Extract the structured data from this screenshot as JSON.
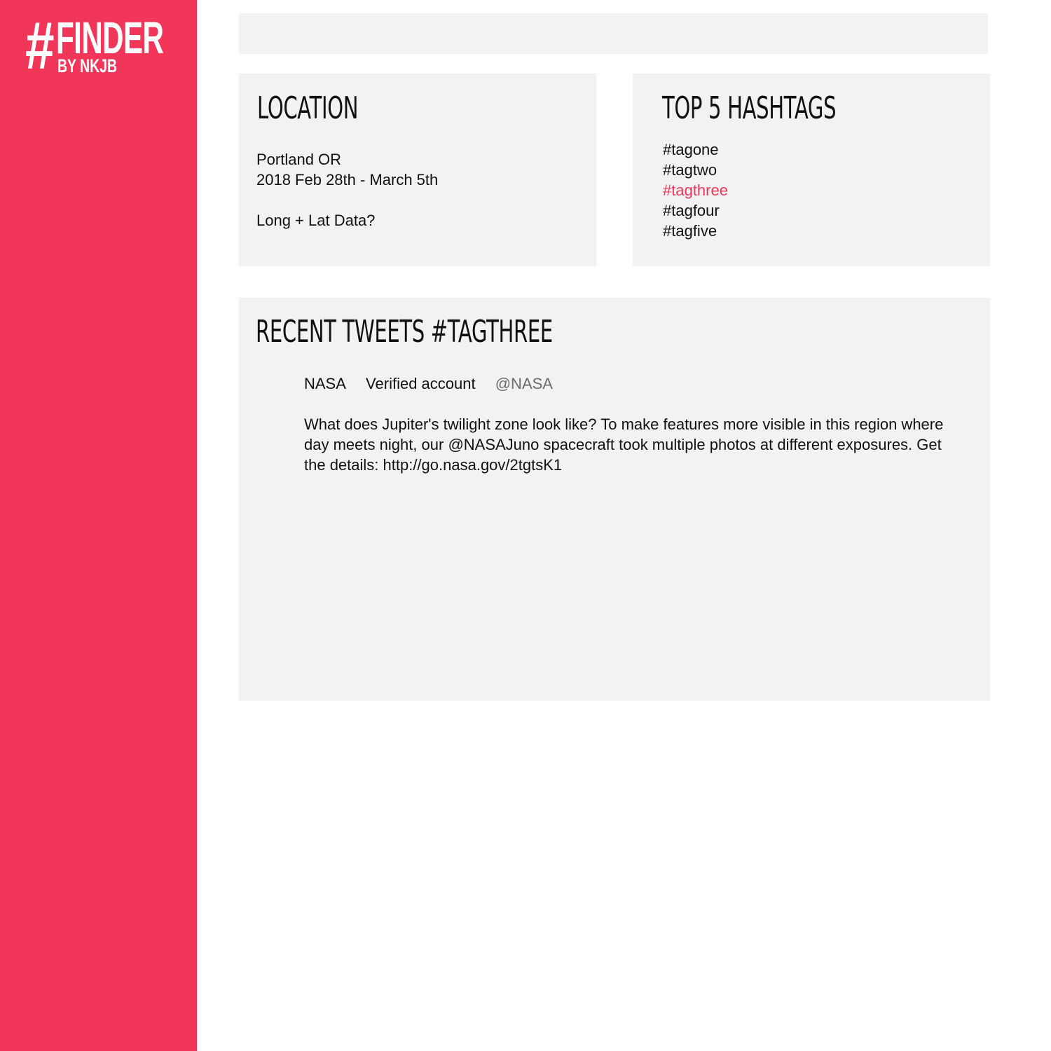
{
  "brand": {
    "hash": "#",
    "name": "FINDER",
    "byline": "BY NKJB",
    "accent_color": "#f1365a"
  },
  "search": {
    "value": "",
    "placeholder": ""
  },
  "location_panel": {
    "title": "LOCATION",
    "place": "Portland OR",
    "date_range": "2018 Feb 28th - March 5th",
    "coords_note": "Long + Lat Data?"
  },
  "hashtags_panel": {
    "title": "TOP 5 HASHTAGS",
    "tags": [
      "#tagone",
      "#tagtwo",
      "#tagthree",
      "#tagfour",
      "#tagfive"
    ],
    "selected": "#tagthree"
  },
  "tweets_panel": {
    "title": "RECENT TWEETS #TAGTHREE",
    "tweets": [
      {
        "name": "NASA",
        "badge": "Verified account",
        "handle": "@NASA",
        "text": "What does Jupiter's twilight zone look like? To make features more visible in this region where day meets night, our @NASAJuno spacecraft took multiple photos at different exposures. Get the details: http://go.nasa.gov/2tgtsK1"
      }
    ]
  }
}
